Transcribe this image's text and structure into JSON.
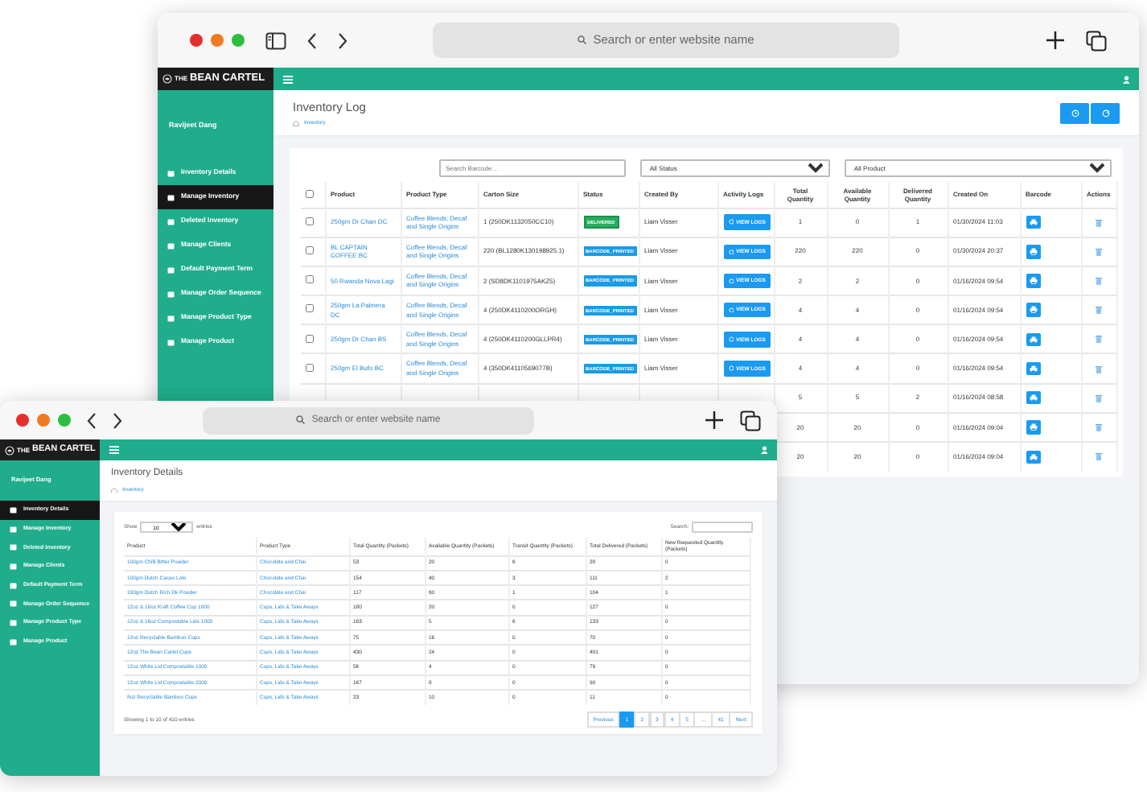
{
  "back_window": {
    "toolbar": {
      "address_placeholder": "Search or enter website name"
    },
    "brand": {
      "small": "THE",
      "name": "BEAN CARTEL"
    },
    "user": "Ravijeet Dang",
    "sidebar": [
      {
        "label": "Inventory Details",
        "selected": false
      },
      {
        "label": "Manage Inventory",
        "selected": true
      },
      {
        "label": "Deleted Inventory",
        "selected": false
      },
      {
        "label": "Manage Clients",
        "selected": false
      },
      {
        "label": "Default Payment Term",
        "selected": false
      },
      {
        "label": "Manage Order Sequence",
        "selected": false
      },
      {
        "label": "Manage Product Type",
        "selected": false
      },
      {
        "label": "Manage Product",
        "selected": false
      }
    ],
    "page": {
      "title": "Inventory Log",
      "breadcrumb": "Inventory"
    },
    "filters": {
      "search_placeholder": "Search Barcode...",
      "status": "All Status",
      "product": "All Product"
    },
    "table": {
      "select_all_checked": false,
      "columns": [
        "Product",
        "Product Type",
        "Carton Size",
        "Status",
        "Created By",
        "Activity Logs",
        "Total Quantity",
        "Available Quantity",
        "Delivered Quantity",
        "Created On",
        "Barcode",
        "Actions"
      ],
      "rows": [
        {
          "checked": false,
          "product": "250gm Dr Chan DC",
          "product_type": "Coffee Blends, Decaf and Single Origins",
          "carton_size": "1 (250DK1132050CC10)",
          "status": {
            "text": "DELIVERED",
            "kind": "delivered"
          },
          "created_by": "Liam Visser",
          "logs_button": "VIEW LOGS",
          "total": "1",
          "available": "0",
          "delivered": "1",
          "created_on": "01/30/2024 11:03"
        },
        {
          "checked": false,
          "product": "BL CAPTAIN COFFEE BC",
          "product_type": "Coffee Blends, Decaf and Single Origins",
          "carton_size": "220 (BL1280K130198925.1)",
          "status": {
            "text": "BARCODE_PRINTED",
            "kind": "printed"
          },
          "created_by": "Liam Visser",
          "logs_button": "VIEW LOGS",
          "total": "220",
          "available": "220",
          "delivered": "0",
          "created_on": "01/30/2024 20:37"
        },
        {
          "checked": false,
          "product": "50 Rwanda Nova Lagi",
          "product_type": "Coffee Blends, Decaf and Single Origins",
          "carton_size": "2 (SD8DK1101975AKZ5)",
          "status": {
            "text": "BARCODE_PRINTED",
            "kind": "printed"
          },
          "created_by": "Liam Visser",
          "logs_button": "VIEW LOGS",
          "total": "2",
          "available": "2",
          "delivered": "0",
          "created_on": "01/16/2024 09:54"
        },
        {
          "checked": false,
          "product": "250gm La Palmera DC",
          "product_type": "Coffee Blends, Decaf and Single Origins",
          "carton_size": "4 (250DK4110200ORGH)",
          "status": {
            "text": "BARCODE_PRINTED",
            "kind": "printed"
          },
          "created_by": "Liam Visser",
          "logs_button": "VIEW LOGS",
          "total": "4",
          "available": "4",
          "delivered": "0",
          "created_on": "01/16/2024 09:54"
        },
        {
          "checked": false,
          "product": "250gm Dr Chan BS",
          "product_type": "Coffee Blends, Decaf and Single Origins",
          "carton_size": "4 (250DK4110200GLLPR4)",
          "status": {
            "text": "BARCODE_PRINTED",
            "kind": "printed"
          },
          "created_by": "Liam Visser",
          "logs_button": "VIEW LOGS",
          "total": "4",
          "available": "4",
          "delivered": "0",
          "created_on": "01/16/2024 09:54"
        },
        {
          "checked": false,
          "product": "250gm El Bufo BC",
          "product_type": "Coffee Blends, Decaf and Single Origins",
          "carton_size": "4 (350DK4110569077B)",
          "status": {
            "text": "BARCODE_PRINTED",
            "kind": "printed"
          },
          "created_by": "Liam Visser",
          "logs_button": "VIEW LOGS",
          "total": "4",
          "available": "4",
          "delivered": "0",
          "created_on": "01/16/2024 09:54"
        },
        {
          "total": "5",
          "available": "5",
          "delivered": "2",
          "created_on": "01/16/2024 08:58"
        },
        {
          "total": "20",
          "available": "20",
          "delivered": "0",
          "created_on": "01/16/2024 09:04"
        },
        {
          "total": "20",
          "available": "20",
          "delivered": "0",
          "created_on": "01/16/2024 09:04"
        }
      ]
    }
  },
  "front_window": {
    "toolbar": {
      "address_placeholder": "Search or enter website name"
    },
    "brand": {
      "small": "THE",
      "name": "BEAN CARTEL"
    },
    "user": "Ravijeet Dang",
    "sidebar": [
      {
        "label": "Inventory Details",
        "selected": true
      },
      {
        "label": "Manage Inventory",
        "selected": false
      },
      {
        "label": "Deleted Inventory",
        "selected": false
      },
      {
        "label": "Manage Clients",
        "selected": false
      },
      {
        "label": "Default Payment Term",
        "selected": false
      },
      {
        "label": "Manage Order Sequence",
        "selected": false
      },
      {
        "label": "Manage Product Type",
        "selected": false
      },
      {
        "label": "Manage Product",
        "selected": false
      }
    ],
    "page": {
      "title": "Inventory Details",
      "breadcrumb": "Inventory"
    },
    "length": {
      "before": "Show",
      "value": "10",
      "after": "entries"
    },
    "search_label": "Search:",
    "table": {
      "columns": [
        "Product",
        "Product Type",
        "Total Quantity (Packets)",
        "Available Quantity (Packets)",
        "Transit Quantity (Packets)",
        "Total Delivered (Packets)",
        "New Requested Quantity (Packets)"
      ],
      "rows": [
        [
          "100gm Chilli Bitter Powder",
          "Chocolate and Chai",
          "53",
          "20",
          "6",
          "28",
          "0"
        ],
        [
          "100gm Dutch Cacao Lolo",
          "Chocolate and Chai",
          "154",
          "40",
          "3",
          "111",
          "2"
        ],
        [
          "100gm Dutch Rich Dk Powder",
          "Chocolate and Chai",
          "117",
          "60",
          "1",
          "104",
          "1"
        ],
        [
          "12oz & 16oz Kraft Coffee Cup 1000",
          "Cups, Lids & Take Aways",
          "180",
          "20",
          "0",
          "127",
          "0"
        ],
        [
          "12oz & 16oz Compostable Lids 1000",
          "Cups, Lids & Take Aways",
          "163",
          "5",
          "6",
          "133",
          "0"
        ],
        [
          "12oz Recyclable Bamboo Cups",
          "Cups, Lids & Take Aways",
          "75",
          "16",
          "0",
          "70",
          "0"
        ],
        [
          "12oz The Bean Cartel Cups",
          "Cups, Lids & Take Aways",
          "430",
          "24",
          "0",
          "401",
          "0"
        ],
        [
          "12oz White Lid Compostable 1000",
          "Cups, Lids & Take Aways",
          "56",
          "4",
          "0",
          "79",
          "0"
        ],
        [
          "12oz White Lid Compostable 2000",
          "Cups, Lids & Take Aways",
          "167",
          "8",
          "0",
          "90",
          "0"
        ],
        [
          "8oz Recyclable Bamboo Cups",
          "Cups, Lids & Take Aways",
          "23",
          "10",
          "0",
          "11",
          "0"
        ]
      ]
    },
    "info": "Showing 1 to 10 of 410 entries",
    "pagination": [
      {
        "label": "Previous",
        "selected": false
      },
      {
        "label": "1",
        "selected": true
      },
      {
        "label": "2",
        "selected": false
      },
      {
        "label": "3",
        "selected": false
      },
      {
        "label": "4",
        "selected": false
      },
      {
        "label": "5",
        "selected": false
      },
      {
        "label": "…",
        "selected": false
      },
      {
        "label": "41",
        "selected": false
      },
      {
        "label": "Next",
        "selected": false
      }
    ]
  }
}
